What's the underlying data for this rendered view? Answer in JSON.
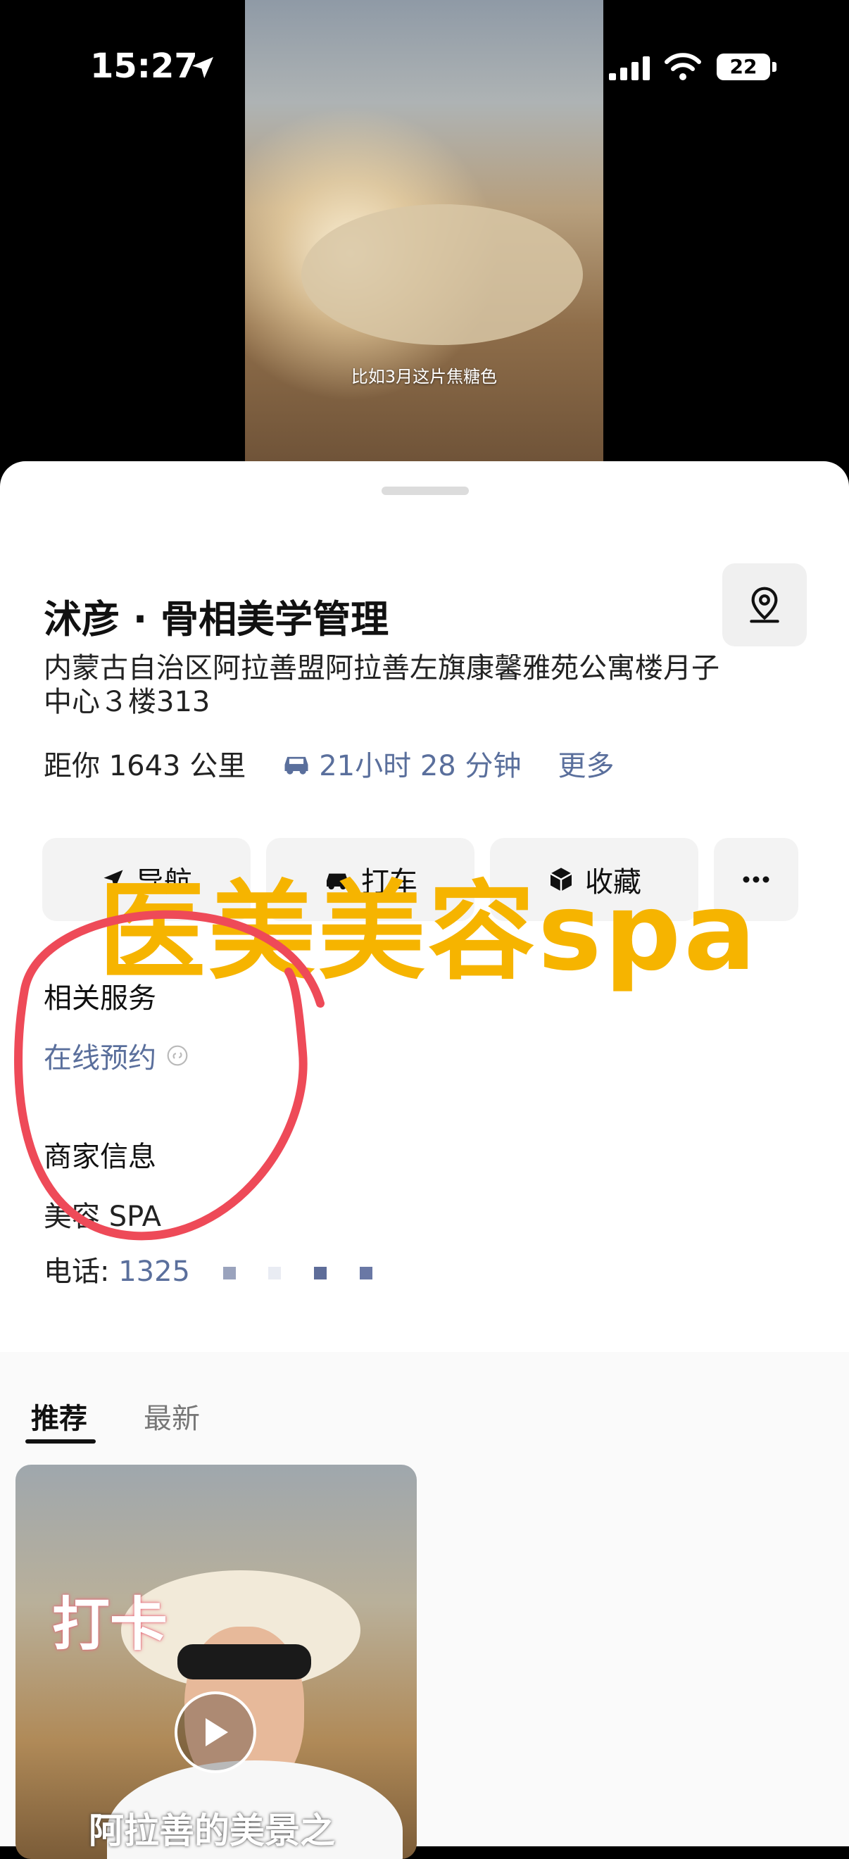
{
  "status_bar": {
    "time": "15:27",
    "battery": "22"
  },
  "video": {
    "caption": "比如3月这片焦糖色"
  },
  "place": {
    "name": "沭彦 · 骨相美学管理",
    "address": "内蒙古自治区阿拉善盟阿拉善左旗康馨雅苑公寓楼月子中心３楼313",
    "distance": "距你 1643 公里",
    "drive_time": "21小时 28 分钟",
    "more": "更多"
  },
  "actions": {
    "navigate": "导航",
    "taxi": "打车",
    "favorite": "收藏"
  },
  "overlay_text": "医美美容spa",
  "services": {
    "label": "相关服务",
    "booking": "在线预约"
  },
  "merchant": {
    "label": "商家信息",
    "category": "美容 SPA",
    "phone_label": "电话: ",
    "phone_partial": "1325"
  },
  "tabs": {
    "recommended": "推荐",
    "latest": "最新"
  },
  "feed_card": {
    "sticker": "打卡",
    "title": "阿拉善的美景之"
  },
  "colors": {
    "accent_link": "#5a6f9c",
    "overlay": "#f6b400",
    "annotation_circle": "#ee4a58"
  }
}
